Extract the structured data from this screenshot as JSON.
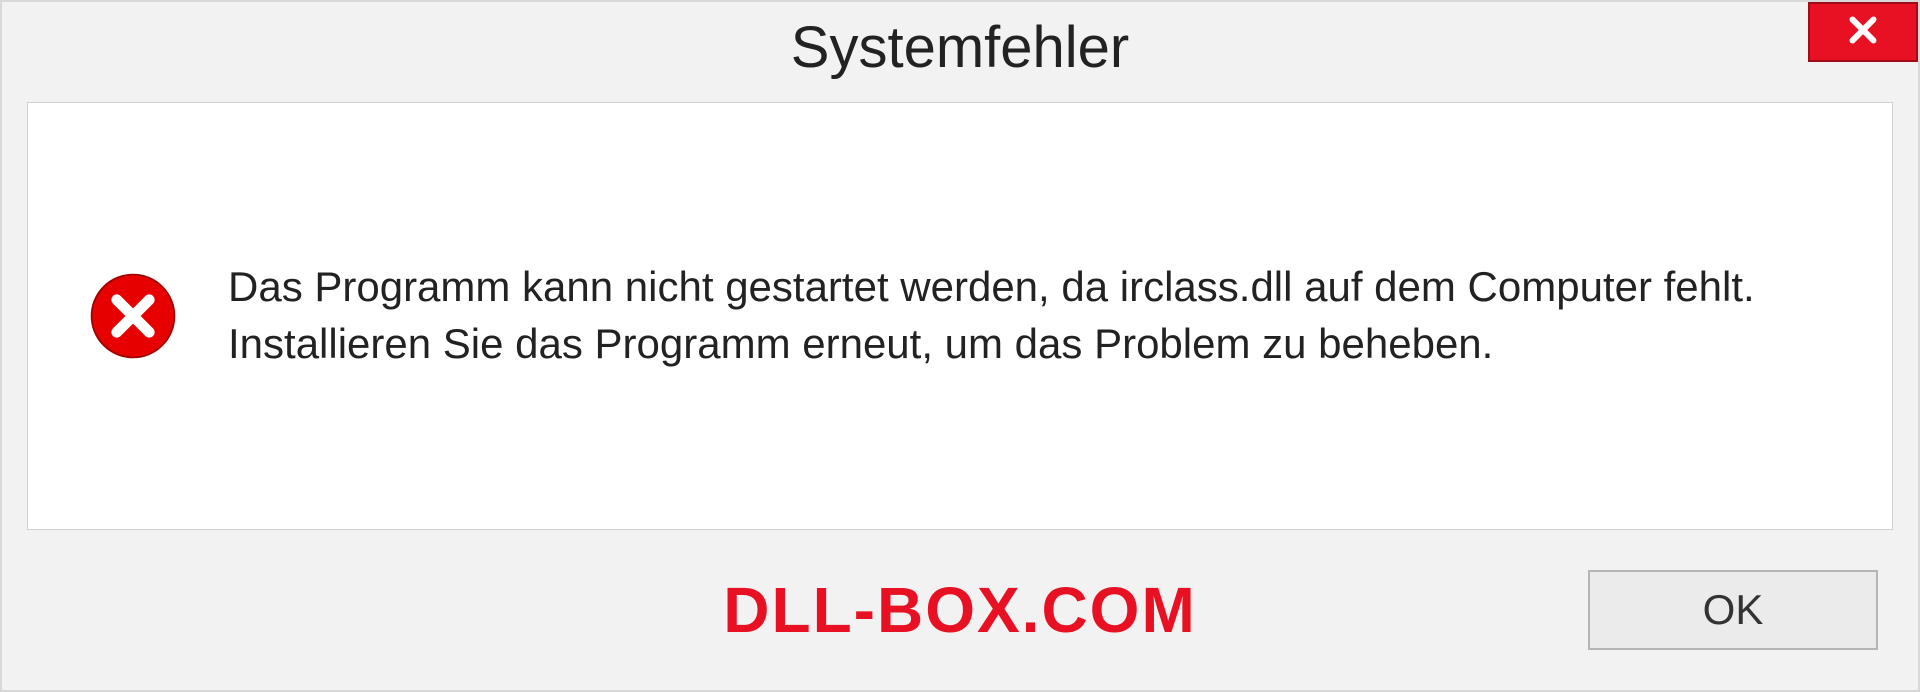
{
  "dialog": {
    "title": "Systemfehler",
    "message": "Das Programm kann nicht gestartet werden, da irclass.dll auf dem Computer fehlt. Installieren Sie das Programm erneut, um das Problem zu beheben.",
    "ok_label": "OK"
  },
  "watermark": "DLL-BOX.COM",
  "colors": {
    "close_bg": "#e81123",
    "error_icon": "#e60000"
  }
}
